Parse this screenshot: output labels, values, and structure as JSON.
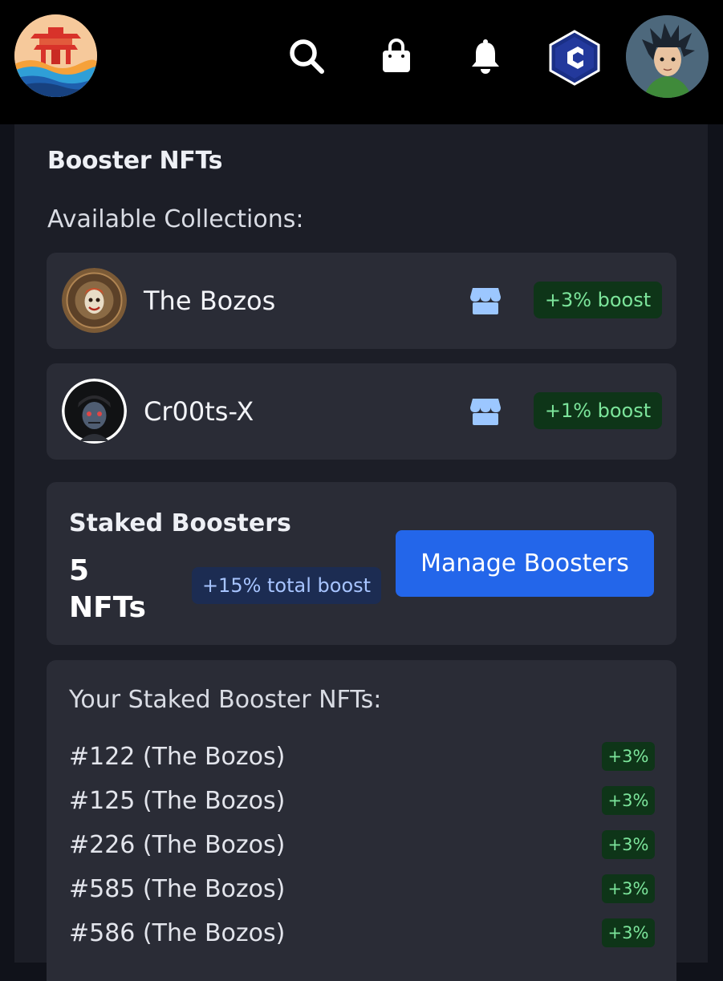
{
  "header": {
    "logo": "pagoda-logo",
    "icons": [
      "search-icon",
      "shopping-bag-icon",
      "bell-icon",
      "chain-c-icon",
      "user-avatar"
    ]
  },
  "booster": {
    "title": "Booster NFTs",
    "collections_label": "Available Collections:",
    "collections": [
      {
        "name": "The Bozos",
        "boost": "+3% boost",
        "icon": "store-icon"
      },
      {
        "name": "Cr00ts-X",
        "boost": "+1% boost",
        "icon": "store-icon"
      }
    ]
  },
  "staked": {
    "title": "Staked Boosters",
    "count_line1": "5",
    "count_line2": "NFTs",
    "total_boost": "+15% total boost",
    "manage_label": "Manage Boosters"
  },
  "staked_list": {
    "title": "Your Staked Booster NFTs:",
    "items": [
      {
        "label": "#122 (The Bozos)",
        "boost": "+3%"
      },
      {
        "label": "#125 (The Bozos)",
        "boost": "+3%"
      },
      {
        "label": "#226 (The Bozos)",
        "boost": "+3%"
      },
      {
        "label": "#585 (The Bozos)",
        "boost": "+3%"
      },
      {
        "label": "#586 (The Bozos)",
        "boost": "+3%"
      }
    ]
  },
  "colors": {
    "accent_blue": "#2366ea",
    "boost_green_bg": "#0e3518",
    "boost_green_text": "#7ce59b",
    "card_bg": "#2a2c36",
    "panel_bg": "#1c1e27"
  }
}
